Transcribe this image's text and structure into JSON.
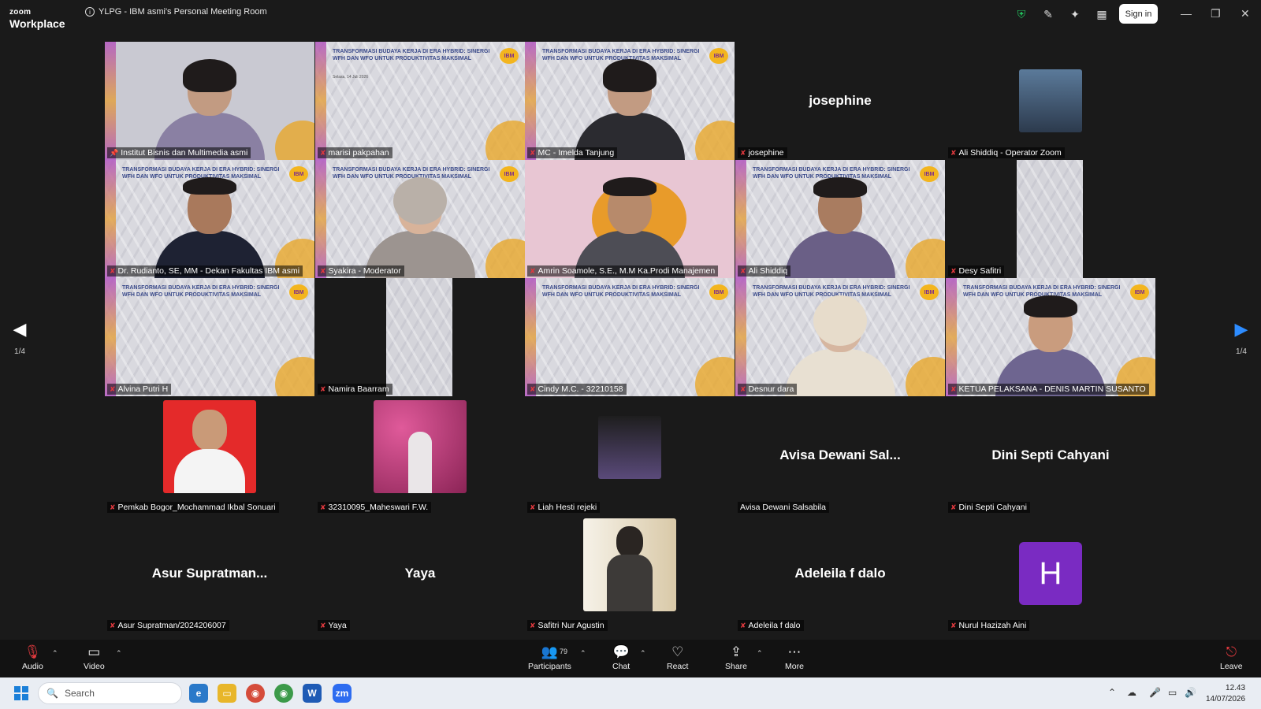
{
  "app": {
    "brand_top": "zoom",
    "brand_bottom": "Workplace",
    "meeting_title": "YLPG - IBM asmi's Personal Meeting Room",
    "sign_in": "Sign in"
  },
  "slide": {
    "title": "Transformasi Budaya Kerja di Era Hybrid: Sinergi WFH dan WFO untuk Produktivitas Maksimal",
    "date": "Selasa, 14 Juli 2026",
    "badge": "IBM"
  },
  "participants": {
    "r1c1": "Institut Bisnis dan Multimedia asmi",
    "r1c2": "marisi pakpahan",
    "r1c3": "MC - Imelda Tanjung",
    "r1c4": "josephine",
    "r1c4_display": "josephine",
    "r1c5": "Ali Shiddiq - Operator Zoom",
    "r2c1": "Dr. Rudianto, SE, MM - Dekan Fakultas IBM asmi",
    "r2c2": "Syakira - Moderator",
    "r2c3": "Amrin Soamole, S.E., M.M Ka.Prodi Manajemen",
    "r2c4": "Ali Shiddiq",
    "r2c5": "Desy Safitri",
    "r3c1": "Alvina Putri H",
    "r3c2": "Namira Baarram",
    "r3c3": "Cindy M.C. - 32210158",
    "r3c4": "Desnur dara",
    "r3c5": "KETUA PELAKSANA - DENIS MARTIN SUSANTO",
    "r4c1": "Pemkab Bogor_Mochammad Ikbal Sonuari",
    "r4c2": "32310095_Maheswari F.W.",
    "r4c3": "Liah Hesti rejeki",
    "r4c4": "Avisa Dewani Salsabila",
    "r4c4_display": "Avisa Dewani Sal...",
    "r4c5": "Dini Septi Cahyani",
    "r4c5_display": "Dini Septi Cahyani",
    "r5c1": "Asur Supratman/2024206007",
    "r5c1_display": "Asur Supratman...",
    "r5c2": "Yaya",
    "r5c2_display": "Yaya",
    "r5c3": "Safitri Nur Agustin",
    "r5c4": "Adeleila f dalo",
    "r5c4_display": "Adeleila f dalo",
    "r5c5": "Nurul Hazizah Aini",
    "r5c5_letter": "H"
  },
  "pager": {
    "left": "1/4",
    "right": "1/4"
  },
  "toolbar": {
    "audio": "Audio",
    "video": "Video",
    "participants": "Participants",
    "participants_count": "79",
    "chat": "Chat",
    "react": "React",
    "share": "Share",
    "more": "More",
    "leave": "Leave"
  },
  "taskbar": {
    "search_placeholder": "Search",
    "time": "12.43",
    "date": "14/07/2026"
  },
  "colors": {
    "active_speaker": "#2ee3a4",
    "leave": "#e0393e",
    "avatar_bg": "#7a2bc2"
  }
}
